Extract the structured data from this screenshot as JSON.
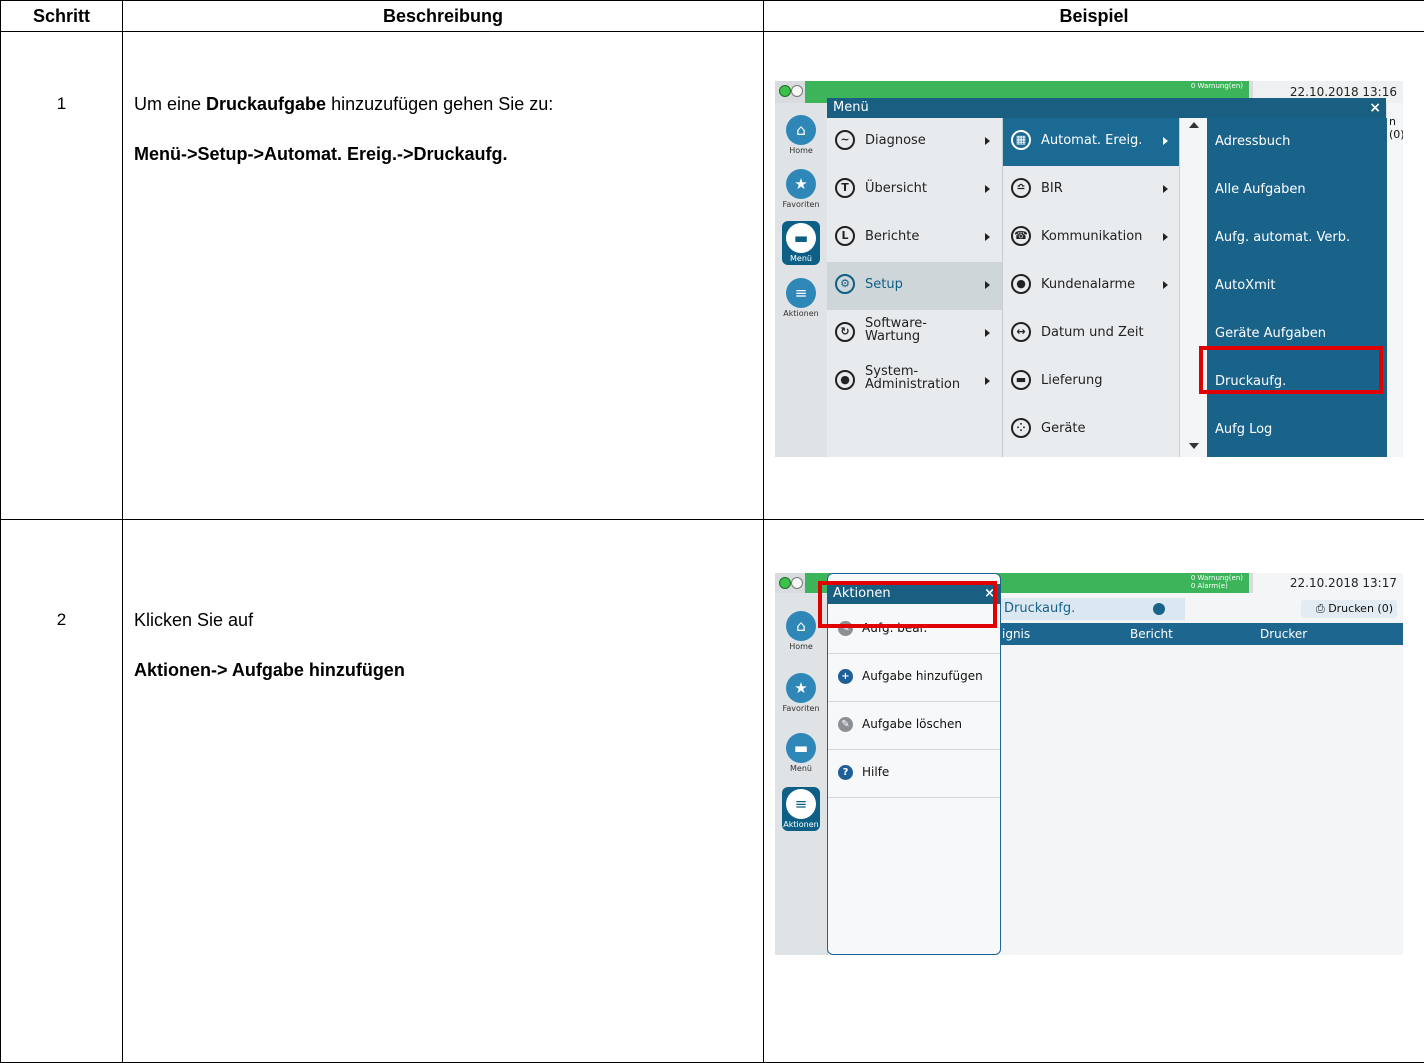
{
  "table": {
    "headers": [
      "Schritt",
      "Beschreibung",
      "Beispiel"
    ],
    "rows": [
      {
        "step": "1",
        "text": "Um eine ",
        "bold": "Druckaufgabe",
        "text2": " hinzuzufügen gehen Sie zu:",
        "path": "Menü->Setup->Automat. Ereig.->Druckaufg."
      },
      {
        "step": "2",
        "text": "Klicken Sie auf",
        "path": "Aktionen-> Aufgabe hinzufügen"
      }
    ]
  },
  "shot1": {
    "status": "0 Warnung(en)",
    "date": "22.10.2018 13:16",
    "right_text": "n (0)",
    "menu_title": "Menü",
    "close": "×",
    "nav": [
      "Home",
      "Favoriten",
      "Menü",
      "Aktionen"
    ],
    "col1": [
      {
        "label": "Diagnose"
      },
      {
        "label": "Übersicht"
      },
      {
        "label": "Berichte"
      },
      {
        "label": "Setup"
      },
      {
        "label": "Software-\nWartung"
      },
      {
        "label": "System-\nAdministration"
      }
    ],
    "col2": [
      "Automat. Ereig.",
      "BIR",
      "Kommunikation",
      "Kundenalarme",
      "Datum und Zeit",
      "Lieferung",
      "Geräte"
    ],
    "col3": [
      "Adressbuch",
      "Alle Aufgaben",
      "Aufg. automat. Verb.",
      "AutoXmit",
      "Geräte Aufgaben",
      "Druckaufg.",
      "Aufg Log"
    ]
  },
  "shot2": {
    "status1": "0 Warnung(en)",
    "status2": "0 Alarm(e)",
    "date": "22.10.2018 13:17",
    "panel_title": "Aktionen",
    "close": "×",
    "crumb": "Druckaufg.",
    "print": "Drucken (0)",
    "columns": [
      "ignis",
      "Bericht",
      "Drucker"
    ],
    "items": [
      "Aufg. bear.",
      "Aufgabe hinzufügen",
      "Aufgabe löschen",
      "Hilfe"
    ],
    "nav": [
      "Home",
      "Favoriten",
      "Menü",
      "Aktionen"
    ]
  }
}
